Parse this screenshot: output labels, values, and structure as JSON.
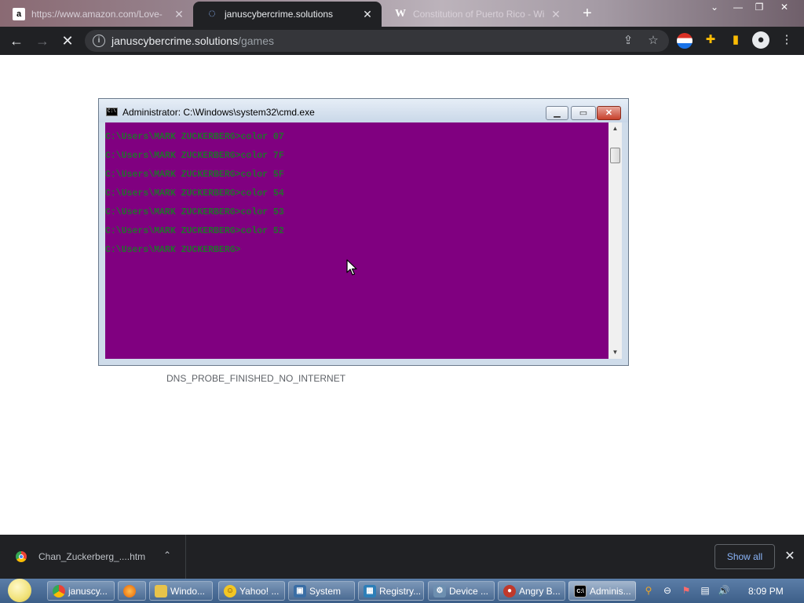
{
  "tabs": [
    {
      "label": "https://www.amazon.com/Love-",
      "icon": "amazon-icon",
      "glyph": "a",
      "active": false
    },
    {
      "label": "januscybercrime.solutions",
      "icon": "loading-spinner-icon",
      "glyph": "◌",
      "active": true
    },
    {
      "label": "Constitution of Puerto Rico - Wi",
      "icon": "wikipedia-icon",
      "glyph": "W",
      "active": false
    }
  ],
  "new_tab_label": "+",
  "address": {
    "host": "januscybercrime.solutions",
    "path": "/games"
  },
  "cmd_window": {
    "title": "Administrator: C:\\Windows\\system32\\cmd.exe",
    "lines": [
      "C:\\Users\\MARK ZUCKERBERG>color 07",
      "C:\\Users\\MARK ZUCKERBERG>color 7F",
      "C:\\Users\\MARK ZUCKERBERG>color 5F",
      "C:\\Users\\MARK ZUCKERBERG>color 54",
      "C:\\Users\\MARK ZUCKERBERG>color 53",
      "C:\\Users\\MARK ZUCKERBERG>color 52",
      "C:\\Users\\MARK ZUCKERBERG>"
    ],
    "background_color": "#800080",
    "text_color": "#236f2e"
  },
  "error_code": "DNS_PROBE_FINISHED_NO_INTERNET",
  "download": {
    "file_name": "Chan_Zuckerberg_....htm",
    "show_all_label": "Show all"
  },
  "taskbar": {
    "items": [
      {
        "label": "januscy...",
        "icon": "chrome-icon",
        "color": "#4285f4"
      },
      {
        "label": "",
        "icon": "firefox-icon",
        "color": "#e66000"
      },
      {
        "label": "Windo...",
        "icon": "folder-icon",
        "color": "#e8c34a"
      },
      {
        "label": "Yahoo! ...",
        "icon": "yahoo-messenger-icon",
        "color": "#f3c623"
      },
      {
        "label": "System",
        "icon": "system-icon",
        "color": "#3a6ea5"
      },
      {
        "label": "Registry...",
        "icon": "registry-icon",
        "color": "#2d7fb8"
      },
      {
        "label": "Device ...",
        "icon": "device-manager-icon",
        "color": "#6d8fb0"
      },
      {
        "label": "Angry B...",
        "icon": "angry-birds-icon",
        "color": "#c0392b"
      },
      {
        "label": "Adminis...",
        "icon": "cmd-icon",
        "color": "#000000"
      }
    ],
    "clock": "8:09 PM"
  }
}
